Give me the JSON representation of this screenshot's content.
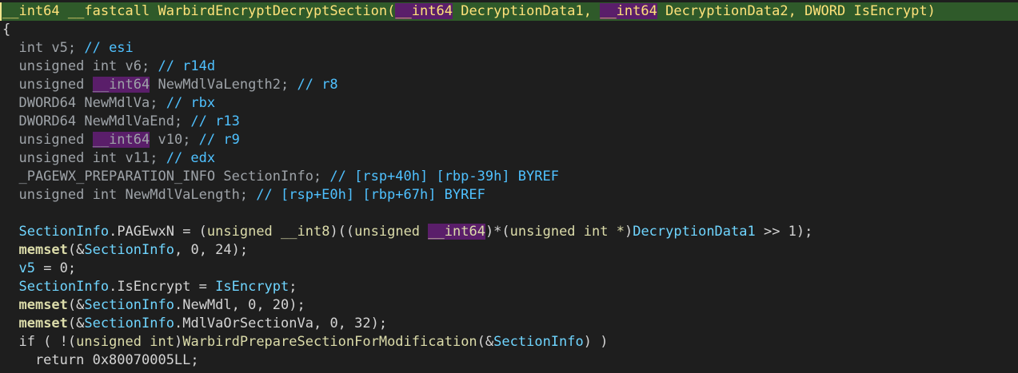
{
  "colors": {
    "background": "#1e1e1e",
    "header_highlight": "#2f5a2a",
    "selection_purple": "#5a1e6a",
    "comment_blue": "#4fc1ff",
    "keyword_yellow": "#dcdcaa"
  },
  "code_lines": [
    {
      "highlighted": true,
      "tokens": [
        {
          "t": "__int64",
          "c": "t-kw"
        },
        {
          "t": " __fastcall ",
          "c": "t-plain"
        },
        {
          "t": "WarbirdEncryptDecryptSection",
          "c": "t-func"
        },
        {
          "t": "(",
          "c": "t-punct"
        },
        {
          "t": "__int64",
          "c": "t-kw",
          "sel": true
        },
        {
          "t": " DecryptionData1, ",
          "c": "t-plain"
        },
        {
          "t": "__int64",
          "c": "t-kw",
          "sel": true
        },
        {
          "t": " DecryptionData2, DWORD IsEncrypt)",
          "c": "t-plain"
        }
      ]
    },
    {
      "tokens": [
        {
          "t": "{",
          "c": "t-brace"
        }
      ]
    },
    {
      "tokens": [
        {
          "t": "  int v5; ",
          "c": "t-type"
        },
        {
          "t": "// esi",
          "c": "t-comment"
        }
      ]
    },
    {
      "tokens": [
        {
          "t": "  unsigned int v6; ",
          "c": "t-type"
        },
        {
          "t": "// r14d",
          "c": "t-comment"
        }
      ]
    },
    {
      "tokens": [
        {
          "t": "  unsigned ",
          "c": "t-type"
        },
        {
          "t": "__int64",
          "c": "t-type",
          "sel": true
        },
        {
          "t": " NewMdlVaLength2; ",
          "c": "t-type"
        },
        {
          "t": "// r8",
          "c": "t-comment"
        }
      ]
    },
    {
      "tokens": [
        {
          "t": "  DWORD64 NewMdlVa; ",
          "c": "t-type"
        },
        {
          "t": "// rbx",
          "c": "t-comment"
        }
      ]
    },
    {
      "tokens": [
        {
          "t": "  DWORD64 NewMdlVaEnd; ",
          "c": "t-type"
        },
        {
          "t": "// r13",
          "c": "t-comment"
        }
      ]
    },
    {
      "tokens": [
        {
          "t": "  unsigned ",
          "c": "t-type"
        },
        {
          "t": "__int64",
          "c": "t-type",
          "sel": true
        },
        {
          "t": " v10; ",
          "c": "t-type"
        },
        {
          "t": "// r9",
          "c": "t-comment"
        }
      ]
    },
    {
      "tokens": [
        {
          "t": "  unsigned int v11; ",
          "c": "t-type"
        },
        {
          "t": "// edx",
          "c": "t-comment"
        }
      ]
    },
    {
      "tokens": [
        {
          "t": "  _PAGEWX_PREPARATION_INFO SectionInfo; ",
          "c": "t-type"
        },
        {
          "t": "// [rsp+40h] [rbp-39h] BYREF",
          "c": "t-comment"
        }
      ]
    },
    {
      "tokens": [
        {
          "t": "  unsigned int NewMdlVaLength; ",
          "c": "t-type"
        },
        {
          "t": "// [rsp+E0h] [rbp+67h] BYREF",
          "c": "t-comment"
        }
      ]
    },
    {
      "tokens": [
        {
          "t": "",
          "c": "t-plain"
        }
      ]
    },
    {
      "tokens": [
        {
          "t": "  ",
          "c": "t-plain"
        },
        {
          "t": "SectionInfo",
          "c": "t-paramvar"
        },
        {
          "t": ".PAGEwxN = (",
          "c": "t-plain"
        },
        {
          "t": "unsigned __int8",
          "c": "t-kw"
        },
        {
          "t": ")((",
          "c": "t-plain"
        },
        {
          "t": "unsigned ",
          "c": "t-kw"
        },
        {
          "t": "__int64",
          "c": "t-kw",
          "sel": true
        },
        {
          "t": ")*(",
          "c": "t-plain"
        },
        {
          "t": "unsigned int *",
          "c": "t-kw"
        },
        {
          "t": ")",
          "c": "t-plain"
        },
        {
          "t": "DecryptionData1",
          "c": "t-paramvar"
        },
        {
          "t": " >> 1);",
          "c": "t-plain"
        }
      ]
    },
    {
      "tokens": [
        {
          "t": "  ",
          "c": "t-plain"
        },
        {
          "t": "memset",
          "c": "t-func-bold"
        },
        {
          "t": "(&",
          "c": "t-plain"
        },
        {
          "t": "SectionInfo",
          "c": "t-paramvar"
        },
        {
          "t": ", 0, 24);",
          "c": "t-plain"
        }
      ]
    },
    {
      "tokens": [
        {
          "t": "  ",
          "c": "t-plain"
        },
        {
          "t": "v5",
          "c": "t-paramvar"
        },
        {
          "t": " = 0;",
          "c": "t-plain"
        }
      ]
    },
    {
      "tokens": [
        {
          "t": "  ",
          "c": "t-plain"
        },
        {
          "t": "SectionInfo",
          "c": "t-paramvar"
        },
        {
          "t": ".IsEncrypt = ",
          "c": "t-plain"
        },
        {
          "t": "IsEncrypt",
          "c": "t-paramvar"
        },
        {
          "t": ";",
          "c": "t-plain"
        }
      ]
    },
    {
      "tokens": [
        {
          "t": "  ",
          "c": "t-plain"
        },
        {
          "t": "memset",
          "c": "t-func-bold"
        },
        {
          "t": "(&",
          "c": "t-plain"
        },
        {
          "t": "SectionInfo",
          "c": "t-paramvar"
        },
        {
          "t": ".NewMdl, 0, 20);",
          "c": "t-plain"
        }
      ]
    },
    {
      "tokens": [
        {
          "t": "  ",
          "c": "t-plain"
        },
        {
          "t": "memset",
          "c": "t-func-bold"
        },
        {
          "t": "(&",
          "c": "t-plain"
        },
        {
          "t": "SectionInfo",
          "c": "t-paramvar"
        },
        {
          "t": ".MdlVaOrSectionVa, 0, 32);",
          "c": "t-plain"
        }
      ]
    },
    {
      "tokens": [
        {
          "t": "  if ( !(",
          "c": "t-plain"
        },
        {
          "t": "unsigned int",
          "c": "t-kw"
        },
        {
          "t": ")",
          "c": "t-plain"
        },
        {
          "t": "WarbirdPrepareSectionForModification",
          "c": "t-func"
        },
        {
          "t": "(&",
          "c": "t-plain"
        },
        {
          "t": "SectionInfo",
          "c": "t-paramvar"
        },
        {
          "t": ") )",
          "c": "t-plain"
        }
      ]
    },
    {
      "tokens": [
        {
          "t": "    return 0x80070005LL;",
          "c": "t-plain"
        }
      ]
    }
  ]
}
